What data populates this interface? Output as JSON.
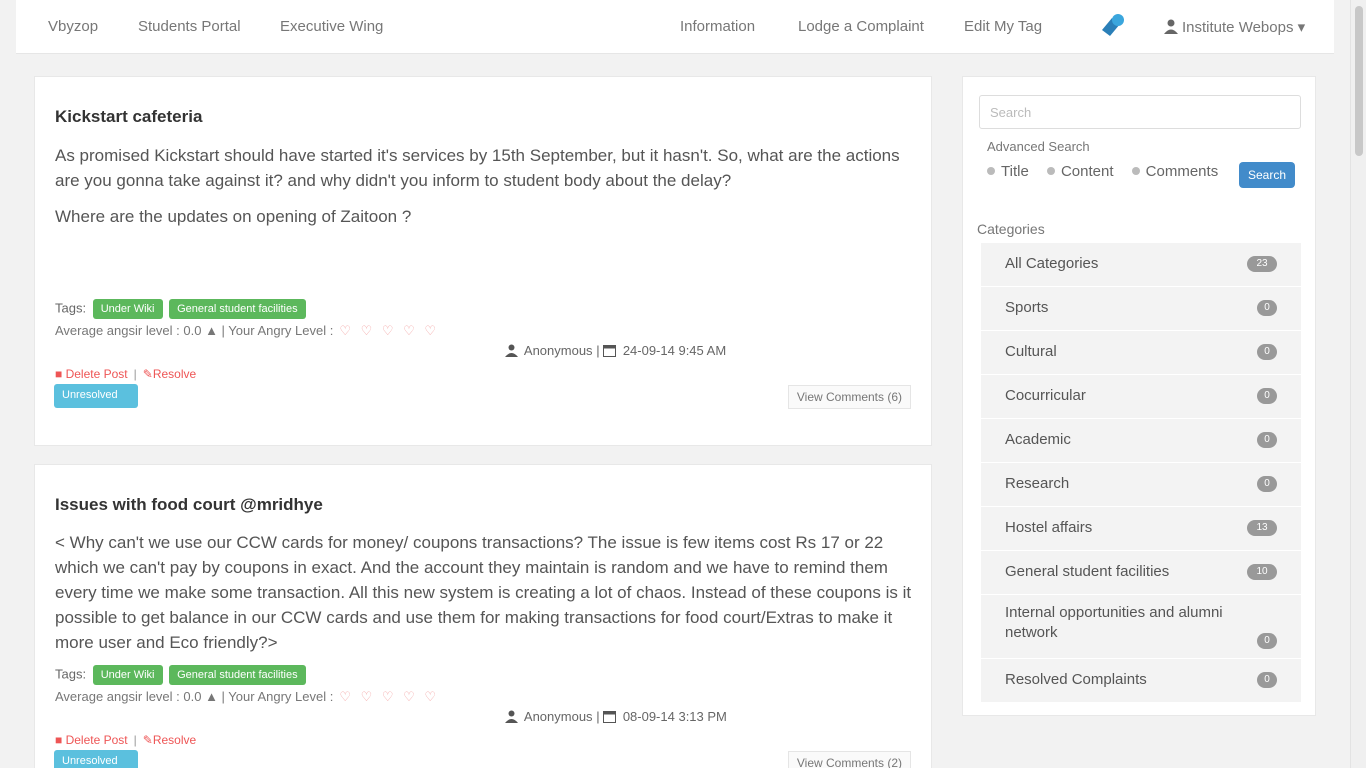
{
  "nav": {
    "brand": "Vbyzop",
    "students_portal": "Students Portal",
    "executive_wing": "Executive Wing",
    "information": "Information",
    "lodge_complaint": "Lodge a Complaint",
    "edit_tag": "Edit My Tag",
    "user": "Institute Webops",
    "user_caret": "▾"
  },
  "posts": [
    {
      "title": "Kickstart cafeteria",
      "body": [
        "As promised Kickstart should have started it's services by 15th September, but it hasn't. So, what are the actions are you gonna take against it? and why didn't you inform to student body about the delay?",
        "Where are the updates on opening of Zaitoon ?"
      ],
      "tags_label": "Tags:",
      "tags": [
        "Under Wiki",
        "General student facilities"
      ],
      "angry_text": "Average angsir level : 0.0 ▲ | Your Angry Level :",
      "hearts": "♡ ♡ ♡ ♡ ♡",
      "author": "Anonymous",
      "date": "24-09-14 9:45 AM",
      "delete_label": "Delete Post",
      "resolve_label": "Resolve",
      "status": "Unresolved",
      "comments_label": "View Comments (6)"
    },
    {
      "title": "Issues with food court @mridhye",
      "body": [
        "< Why can't we use our CCW cards for money/ coupons transactions? The issue is few items cost Rs 17 or 22 which we can't pay by coupons in exact. And the account they maintain is random and we have to remind them every time we make some transaction. All this new system is creating a lot of chaos. Instead of these coupons is it possible to get balance in our CCW cards and use them for making transactions for food court/Extras to make it more user and Eco friendly?>"
      ],
      "tags_label": "Tags:",
      "tags": [
        "Under Wiki",
        "General student facilities"
      ],
      "angry_text": "Average angsir level : 0.0 ▲ | Your Angry Level :",
      "hearts": "♡ ♡ ♡ ♡ ♡",
      "author": "Anonymous",
      "date": "08-09-14 3:13 PM",
      "delete_label": "Delete Post",
      "resolve_label": "Resolve",
      "status": "Unresolved",
      "comments_label": "View Comments (2)"
    }
  ],
  "sidebar": {
    "search_placeholder": "Search",
    "advanced_label": "Advanced Search",
    "opt_title": "Title",
    "opt_content": "Content",
    "opt_comments": "Comments",
    "search_button": "Search",
    "categories_heading": "Categories",
    "categories": [
      {
        "label": "All Categories",
        "count": "23"
      },
      {
        "label": "Sports",
        "count": "0"
      },
      {
        "label": "Cultural",
        "count": "0"
      },
      {
        "label": "Cocurricular",
        "count": "0"
      },
      {
        "label": "Academic",
        "count": "0"
      },
      {
        "label": "Research",
        "count": "0"
      },
      {
        "label": "Hostel affairs",
        "count": "13"
      },
      {
        "label": "General student facilities",
        "count": "10"
      },
      {
        "label": "Internal opportunities and alumni network",
        "count": "0"
      },
      {
        "label": "Resolved Complaints",
        "count": "0"
      }
    ]
  },
  "colors": {
    "tag_green": "#5cb85c",
    "status_blue": "#5bc0de",
    "primary_blue": "#428bca",
    "danger_red": "#e55555"
  }
}
